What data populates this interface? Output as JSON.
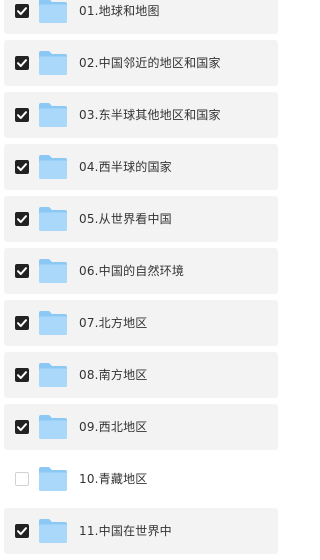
{
  "theme": {
    "row_selected_bg": "#f3f3f3",
    "checkbox_checked": "#222222",
    "folder_back": "#8cc8f4",
    "folder_front": "#a9d8fb"
  },
  "files": [
    {
      "name": "01.地球和地图",
      "checked": true,
      "icon": "folder-icon"
    },
    {
      "name": "02.中国邻近的地区和国家",
      "checked": true,
      "icon": "folder-icon"
    },
    {
      "name": "03.东半球其他地区和国家",
      "checked": true,
      "icon": "folder-icon"
    },
    {
      "name": "04.西半球的国家",
      "checked": true,
      "icon": "folder-icon"
    },
    {
      "name": "05.从世界看中国",
      "checked": true,
      "icon": "folder-icon"
    },
    {
      "name": "06.中国的自然环境",
      "checked": true,
      "icon": "folder-icon"
    },
    {
      "name": "07.北方地区",
      "checked": true,
      "icon": "folder-icon"
    },
    {
      "name": "08.南方地区",
      "checked": true,
      "icon": "folder-icon"
    },
    {
      "name": "09.西北地区",
      "checked": true,
      "icon": "folder-icon"
    },
    {
      "name": "10.青藏地区",
      "checked": false,
      "icon": "folder-icon"
    },
    {
      "name": "11.中国在世界中",
      "checked": true,
      "icon": "folder-icon"
    }
  ]
}
